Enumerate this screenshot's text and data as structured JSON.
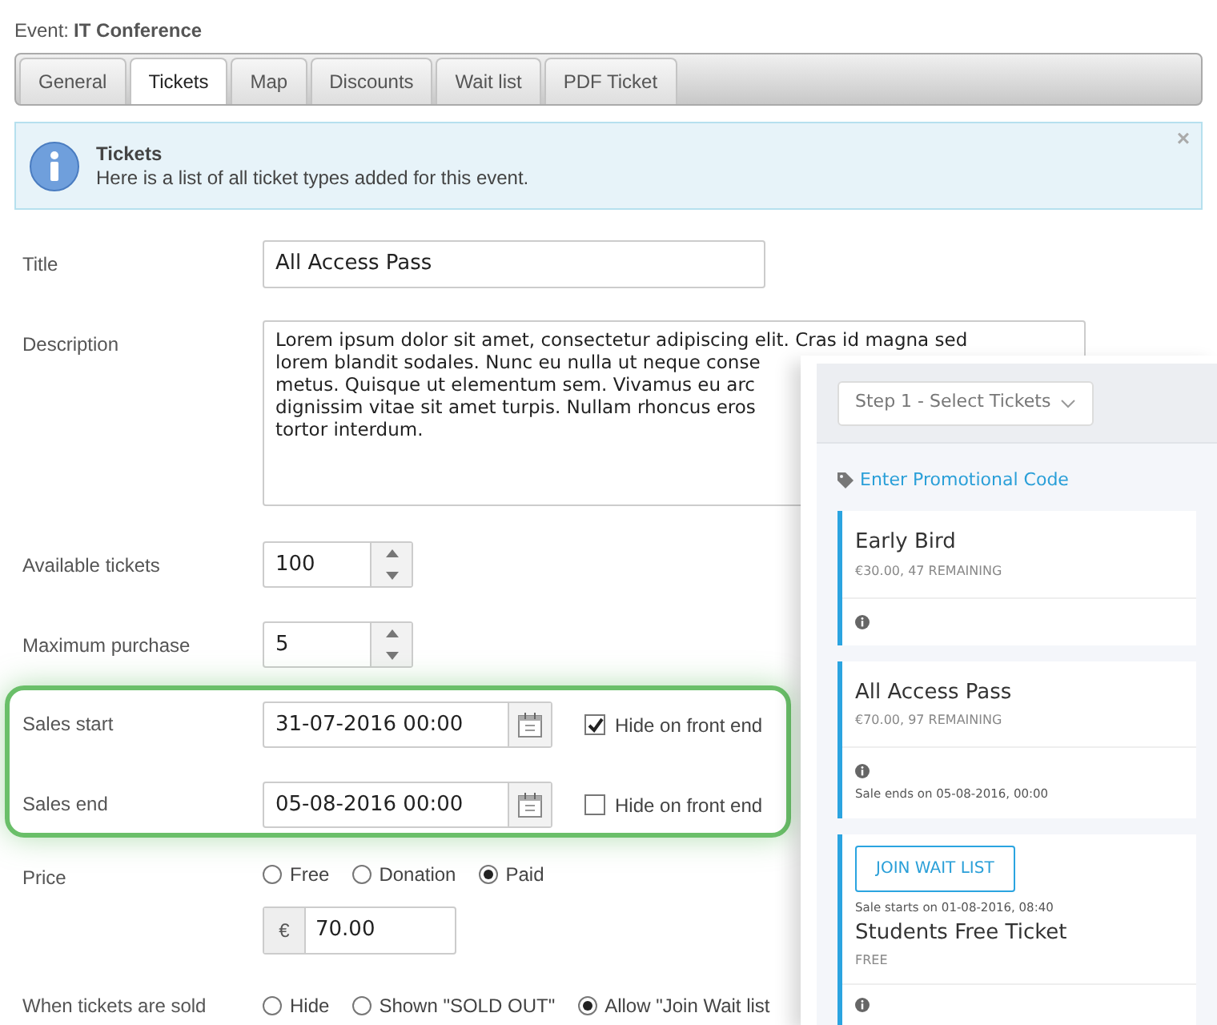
{
  "event": {
    "label": "Event:",
    "name": "IT Conference"
  },
  "tabs": [
    {
      "label": "General",
      "selected": false
    },
    {
      "label": "Tickets",
      "selected": true
    },
    {
      "label": "Map",
      "selected": false
    },
    {
      "label": "Discounts",
      "selected": false
    },
    {
      "label": "Wait list",
      "selected": false
    },
    {
      "label": "PDF Ticket",
      "selected": false
    }
  ],
  "alert": {
    "title": "Tickets",
    "text": "Here is a list of all ticket types added for this event.",
    "close": "×"
  },
  "form": {
    "title": {
      "label": "Title",
      "value": "All Access Pass"
    },
    "description": {
      "label": "Description",
      "lines": [
        "Lorem ipsum dolor sit amet, consectetur adipiscing elit. Cras id magna sed",
        "lorem blandit sodales. Nunc eu nulla ut neque conse",
        "metus. Quisque ut elementum sem. Vivamus eu arc",
        "dignissim vitae sit amet turpis. Nullam rhoncus eros",
        "tortor interdum."
      ]
    },
    "available": {
      "label": "Available tickets",
      "value": "100"
    },
    "max_purchase": {
      "label": "Maximum purchase",
      "value": "5"
    },
    "sales": [
      {
        "label": "Sales start",
        "value": "31-07-2016 00:00",
        "hide_label": "Hide on front end",
        "checked": true
      },
      {
        "label": "Sales end",
        "value": "05-08-2016 00:00",
        "hide_label": "Hide on front end",
        "checked": false
      }
    ],
    "price": {
      "label": "Price",
      "options": [
        {
          "label": "Free",
          "selected": false
        },
        {
          "label": "Donation",
          "selected": false
        },
        {
          "label": "Paid",
          "selected": true
        }
      ],
      "currency": "€",
      "amount": "70.00"
    },
    "when_sold": {
      "label": "When tickets are sold",
      "options": [
        {
          "label": "Hide",
          "selected": false
        },
        {
          "label": "Shown \"SOLD OUT\"",
          "selected": false
        },
        {
          "label": "Allow \"Join Wait list",
          "selected": true
        }
      ]
    }
  },
  "preview": {
    "step": "Step 1 - Select Tickets",
    "promo": "Enter Promotional Code",
    "tickets": [
      {
        "kind": "standard",
        "name": "Early Bird",
        "meta": "€30.00, 47 REMAINING"
      },
      {
        "kind": "standard",
        "name": "All Access Pass",
        "meta": "€70.00, 97 REMAINING",
        "note": "Sale ends on 05-08-2016, 00:00"
      },
      {
        "kind": "waitlist",
        "button": "JOIN WAIT LIST",
        "note": "Sale starts on 01-08-2016, 08:40",
        "name": "Students Free Ticket",
        "meta": "FREE"
      }
    ]
  }
}
